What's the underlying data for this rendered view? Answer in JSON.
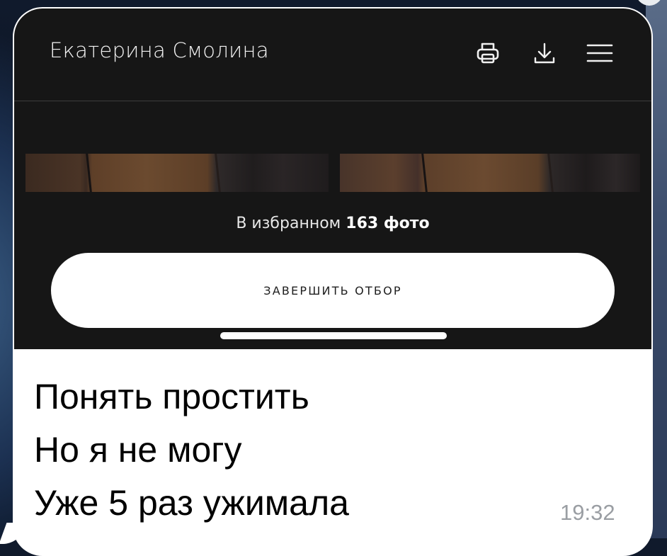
{
  "screen": {
    "title": "Екатерина Смолина",
    "icons": {
      "print": "printer-icon",
      "download": "download-icon",
      "menu": "hamburger-menu-icon"
    },
    "favorites_prefix": "В избранном",
    "favorites_count": "163 фото",
    "finish_button": "ЗАВЕРШИТЬ ОТБОР"
  },
  "message": {
    "lines": [
      "Понять простить",
      "Но я не могу",
      "Уже 5 раз ужимала"
    ],
    "time": "19:32"
  },
  "colors": {
    "screen_bg": "#161616",
    "bubble_bg": "#ffffff",
    "time_text": "#9a9ea3"
  }
}
